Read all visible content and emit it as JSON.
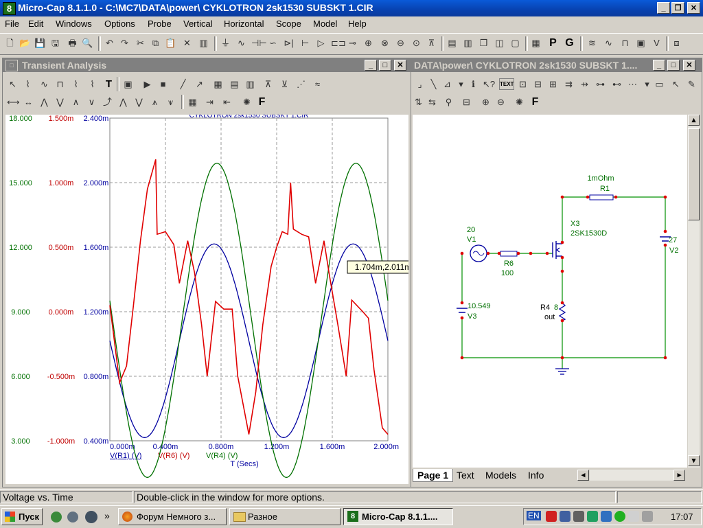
{
  "app": {
    "title": "Micro-Cap 8.1.1.0 - C:\\MC7\\DATA\\power\\ CYKLOTRON 2sk1530 SUBSKT 1.CIR",
    "icon_label": "8"
  },
  "menu": [
    "File",
    "Edit",
    "Windows",
    "Options",
    "Probe",
    "Vertical",
    "Horizontal",
    "Scope",
    "Model",
    "Help"
  ],
  "toolbar_text_buttons": {
    "p": "P",
    "g": "G"
  },
  "transient": {
    "title": "Transient Analysis",
    "plot_title": "CYKLOTRON 2sk1530 SUBSKT 1.CIR",
    "font_button": "F",
    "cursor_readout": "1.704m,2.011m",
    "x_axis_label": "T (Secs)",
    "x_ticks": [
      "0.000m",
      "0.400m",
      "0.800m",
      "1.200m",
      "1.600m",
      "2.000m"
    ],
    "y_green_ticks": [
      "18.000",
      "15.000",
      "12.000",
      "9.000",
      "6.000",
      "3.000"
    ],
    "y_red_ticks": [
      "1.500m",
      "1.000m",
      "0.500m",
      "0.000m",
      "-0.500m",
      "-1.000m"
    ],
    "y_blue_ticks": [
      "2.400m",
      "2.000m",
      "1.600m",
      "1.200m",
      "0.800m",
      "0.400m"
    ],
    "legend": [
      {
        "label": "V(R1) (V)",
        "color": "#0000a0"
      },
      {
        "label": "V(R6) (V)",
        "color": "#c00000"
      },
      {
        "label": "V(R4) (V)",
        "color": "#007000"
      }
    ]
  },
  "schematic": {
    "title": "DATA\\power\\ CYKLOTRON 2sk1530 SUBSKT 1....",
    "font_button": "F",
    "text_button": "TEXT",
    "components": {
      "r1_value": "1mOhm",
      "r1_name": "R1",
      "x3_name": "X3",
      "x3_model": "2SK1530D",
      "v1_value": "20",
      "v1_name": "V1",
      "r6_name": "R6",
      "r6_value": "100",
      "v2_value": "27",
      "v2_name": "V2",
      "v3_value": "10.549",
      "v3_name": "V3",
      "r4_name": "R4",
      "r4_value": "8",
      "r4_node": "out"
    },
    "tabs": [
      "Page 1",
      "Text",
      "Models",
      "Info"
    ]
  },
  "status": {
    "left": "Voltage vs. Time",
    "middle": "Double-click in the window for more options."
  },
  "taskbar": {
    "start": "Пуск",
    "tasks": [
      "Форум Немного з...",
      "Разное",
      "Micro-Cap 8.1.1...."
    ],
    "lang": "EN",
    "clock": "17:07"
  },
  "colors": {
    "accent": "#0842b0",
    "trace_blue": "#0000a0",
    "trace_red": "#c00000",
    "trace_green": "#007000",
    "wire": "#009000",
    "node": "#e00000"
  }
}
